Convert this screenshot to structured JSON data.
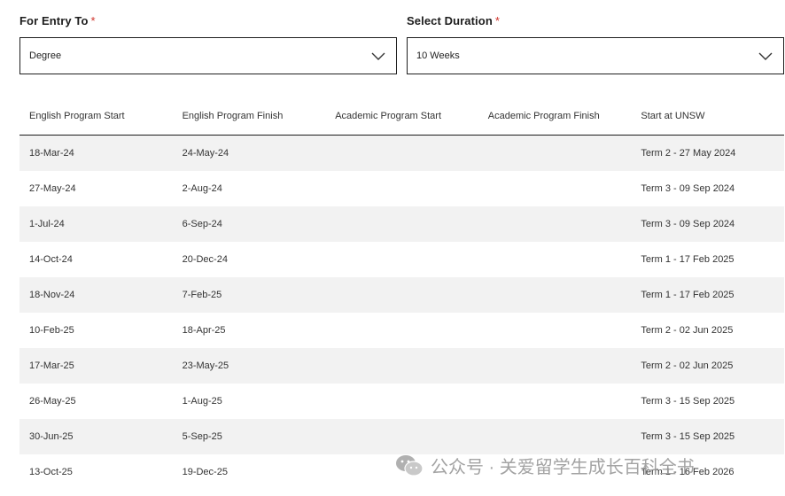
{
  "form": {
    "entry": {
      "label": "For Entry To",
      "required_mark": "*",
      "value": "Degree",
      "icon": "chevron-down-icon"
    },
    "duration": {
      "label": "Select Duration",
      "required_mark": "*",
      "value": "10 Weeks",
      "icon": "chevron-down-icon"
    }
  },
  "table": {
    "headers": [
      "English Program Start",
      "English Program Finish",
      "Academic Program Start",
      "Academic Program Finish",
      "Start at UNSW"
    ],
    "rows": [
      [
        "18-Mar-24",
        "24-May-24",
        "",
        "",
        "Term 2 - 27 May 2024"
      ],
      [
        "27-May-24",
        "2-Aug-24",
        "",
        "",
        "Term 3 - 09 Sep 2024"
      ],
      [
        "1-Jul-24",
        "6-Sep-24",
        "",
        "",
        "Term 3 - 09 Sep 2024"
      ],
      [
        "14-Oct-24",
        "20-Dec-24",
        "",
        "",
        "Term 1 - 17 Feb 2025"
      ],
      [
        "18-Nov-24",
        "7-Feb-25",
        "",
        "",
        "Term 1 - 17 Feb 2025"
      ],
      [
        "10-Feb-25",
        "18-Apr-25",
        "",
        "",
        "Term 2 - 02 Jun 2025"
      ],
      [
        "17-Mar-25",
        "23-May-25",
        "",
        "",
        "Term 2 - 02 Jun 2025"
      ],
      [
        "26-May-25",
        "1-Aug-25",
        "",
        "",
        "Term 3 - 15 Sep 2025"
      ],
      [
        "30-Jun-25",
        "5-Sep-25",
        "",
        "",
        "Term 3 - 15 Sep 2025"
      ],
      [
        "13-Oct-25",
        "19-Dec-25",
        "",
        "",
        "Term 1 - 16 Feb 2026"
      ]
    ]
  },
  "watermark": {
    "icon": "wechat-icon",
    "text": "公众号 · 关爱留学生成长百科全书"
  },
  "colors": {
    "required": "#d0342c",
    "row_stripe": "#f2f2f2",
    "border": "#1f1f1f"
  }
}
